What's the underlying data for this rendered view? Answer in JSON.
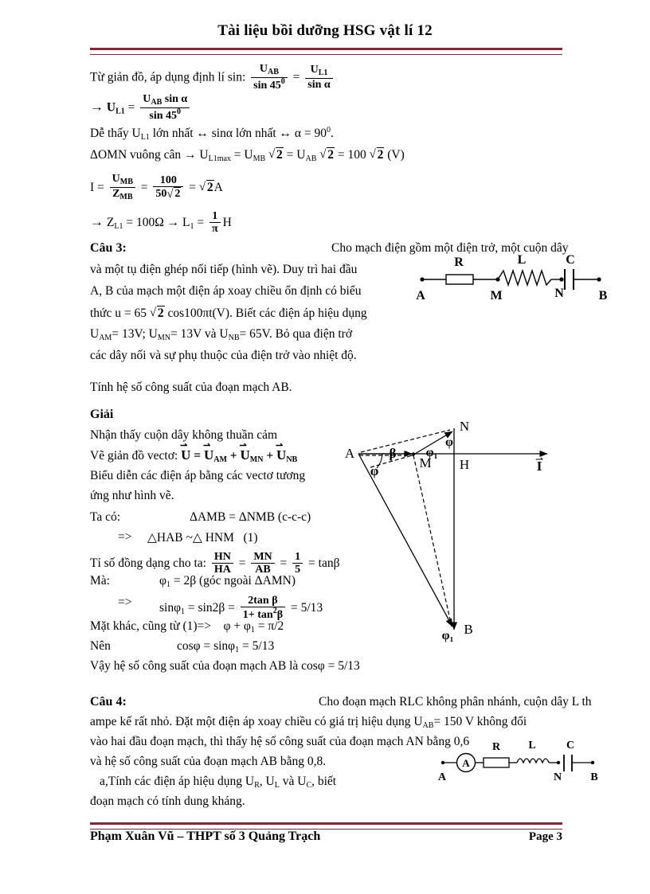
{
  "header": {
    "title": "Tài liệu bồi dưỡng HSG vật lí 12"
  },
  "footer": {
    "author": "Phạm Xuân Vũ – THPT số 3 Quảng Trạch",
    "page": "Page 3"
  },
  "colors": {
    "rule": "#7B2B36",
    "text": "#000000",
    "page_bg": "#FFFFFF"
  },
  "solution_top": {
    "line1_lead": "Từ giản đồ, áp dụng định lí sin:",
    "eq1": {
      "lhs_num": "U",
      "lhs_num_sub": "AB",
      "lhs_den": "sin 45",
      "lhs_den_sup": "0",
      "eq": "=",
      "rhs_num": "U",
      "rhs_num_sub": "L1",
      "rhs_den": "sin",
      "rhs_den_var": "α"
    },
    "eq2": {
      "arrow": "→",
      "lhs": "U",
      "lhs_sub": "L1",
      "eq": "=",
      "num": "U",
      "num_sub": "AB",
      "num_rest": "sin α",
      "den": "sin 45",
      "den_sup": "0"
    },
    "line3": "Dễ thấy U",
    "line3_sub": "L1",
    "line3_rest": "lớn nhất ↔ sinα lớn nhất ↔ α = 90",
    "line3_sup": "0",
    "line3_end": ".",
    "line4_a": "ΔOMN vuông cân → U",
    "line4_sub1": "L1max",
    "line4_b": "= U",
    "line4_sub2": "MB",
    "line4_c": "2",
    "line4_d": "= U",
    "line4_sub3": "AB",
    "line4_e": "2",
    "line4_f": "= 100",
    "line4_g": "2",
    "line4_h": "(V)",
    "eq3": {
      "lhs": "I",
      "eq1": "=",
      "num1": "U",
      "num1_sub": "MB",
      "den1": "Z",
      "den1_sub": "MB",
      "eq2": "=",
      "num2": "100",
      "den2": "50",
      "den2_sqrt": "2",
      "eq3": "=",
      "res_sqrt": "2",
      "unit": "A"
    },
    "eq4": {
      "arrow": "→",
      "z": "Z",
      "z_sub": "L1",
      "z_val": "= 100Ω →",
      "l": "L",
      "l_sub": "1",
      "eq": "=",
      "num": "1",
      "den": "π",
      "unit": "H"
    }
  },
  "cau3": {
    "label": "Câu 3:",
    "intro": "Cho mạch điện gồm một điện trở, một cuộn dây",
    "lines": [
      "và một tụ điện ghép nối tiếp (hình vẽ). Duy trì hai đầu",
      "A, B của mạch một điện áp xoay chiều ổn định có biểu",
      "thức u = 65 2 cos100πt(V). Biết các điện áp hiệu dụng",
      "UAM = 13V; UMN = 13V và UNB = 65V. Bỏ qua điện trở",
      "các dây nối và sự phụ thuộc của điện trở vào nhiệt độ."
    ],
    "line3_a": "thức u = 65",
    "line3_sqrt": "2",
    "line3_b": "cos100πt(V). Biết các điện áp hiệu dụng",
    "line4_a": "U",
    "line4_sub1": "AM",
    "line4_b": "= 13V; U",
    "line4_sub2": "MN",
    "line4_c": "= 13V và U",
    "line4_sub3": "NB",
    "line4_d": "= 65V. Bỏ qua điện trở",
    "question": "Tính hệ số công suất của đoạn mạch AB.",
    "circuit": {
      "labels_top": [
        "R",
        "L",
        "C"
      ],
      "labels_bottom": [
        "A",
        "M",
        "N",
        "B"
      ]
    }
  },
  "giai": {
    "heading": "Giải",
    "l1": "Nhận thấy cuộn dây không thuần cảm",
    "l2_lead": "Vẽ giản đồ vectơ:",
    "l2_eq": {
      "u": "U",
      "eq": "=",
      "u1": "U",
      "u1_sub": "AM",
      "plus1": "+",
      "u2": "U",
      "u2_sub": "MN",
      "plus2": "+",
      "u3": "U",
      "u3_sub": "NB"
    },
    "l3": "Biểu diễn các điện áp bằng các vectơ tương",
    "l4": "ứng như hình vẽ.",
    "l5_lead": "Ta có:",
    "l5_body": "ΔAMB = ΔNMB (c-c-c)",
    "l6_arrow": "=>",
    "l6_body": "HAB ~ HNM      (1)",
    "l6_tri1": "△",
    "l6_tri2": "△",
    "l7_lead": "Tỉ số đồng dạng cho ta:",
    "l7_f1_num": "HN",
    "l7_f1_den": "HA",
    "l7_eq1": "=",
    "l7_f2_num": "MN",
    "l7_f2_den": "AB",
    "l7_eq2": "=",
    "l7_f3_num": "1",
    "l7_f3_den": "5",
    "l7_tail": "= tanβ",
    "l8_lead": "Mà:",
    "l8_body": "φ1 = 2β (góc ngoài ΔAMN)",
    "l8_phi": "φ",
    "l8_phi_sub": "1",
    "l8_rest": "= 2β (góc ngoài ΔAMN)",
    "l9_arrow": "=>",
    "l9_a": "sinφ",
    "l9_a_sub": "1",
    "l9_b": "= sin2β =",
    "l9_num": "2tan β",
    "l9_den": "1+ tan",
    "l9_den_sup": "2",
    "l9_den_rest": "β",
    "l9_tail": "= 5/13",
    "l10": "Mặt khác, cũng từ (1)=>    φ + φ1 = π/2",
    "l10_a": "Mặt khác, cũng từ (1)=>",
    "l10_b": "φ + φ",
    "l10_b_sub": "1",
    "l10_c": "= π/2",
    "l11_lead": "Nên",
    "l11_a": "cosφ = sinφ",
    "l11_a_sub": "1",
    "l11_b": "= 5/13",
    "l12": "Vậy hệ số công suất của đoạn mạch AB là cosφ = 5/13",
    "vector_diagram": {
      "points": [
        "A",
        "M",
        "N",
        "H",
        "B"
      ],
      "angles": [
        "β",
        "φ",
        "φ",
        "φ1",
        "φ1"
      ],
      "axis_label": "I"
    }
  },
  "cau4": {
    "label": "Câu 4:",
    "intro": "Cho đoạn mạch RLC không phân nhánh, cuộn dây L th",
    "l2_a": "ampe kế rất nhỏ. Đặt một điện áp xoay chiều có giá trị hiệu dụng U",
    "l2_sub": "AB",
    "l2_b": "= 150 V không đổi",
    "l3": "vào hai đầu đoạn mạch, thì thấy hệ số công suất của đoạn mạch AN bằng 0,6",
    "l4": "và hệ số công suất của đoạn mạch AB bằng 0,8.",
    "l5_a": "a,Tính các điện áp hiệu dụng U",
    "l5_sub1": "R",
    "l5_b": ", U",
    "l5_sub2": "L",
    "l5_c": " và U",
    "l5_sub3": "C",
    "l5_d": ", biết",
    "l6": "đoạn mạch có tính dung kháng.",
    "circuit": {
      "ammeter": "A",
      "labels_top": [
        "R",
        "L",
        "C"
      ],
      "labels_bottom": [
        "A",
        "N",
        "B"
      ]
    }
  }
}
